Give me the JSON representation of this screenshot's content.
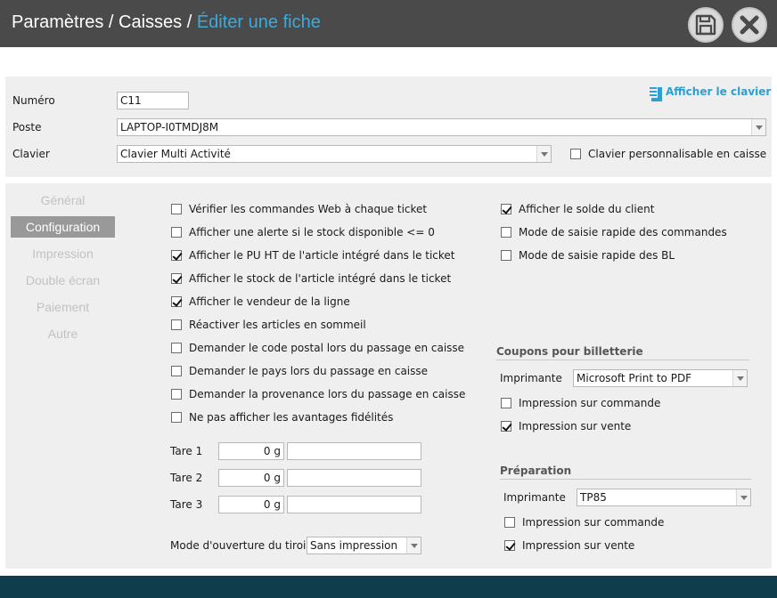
{
  "header": {
    "title_part1": "Paramètres / Caisses / ",
    "title_part2": "Éditer une fiche",
    "save_icon": "save-icon",
    "close_icon": "close-icon"
  },
  "top": {
    "numero_label": "Numéro",
    "numero_value": "C11",
    "poste_label": "Poste",
    "poste_value": "LAPTOP-I0TMDJ8M",
    "clavier_label": "Clavier",
    "clavier_value": "Clavier Multi Activité",
    "clavier_perso_label": "Clavier personnalisable en caisse",
    "clavier_perso_checked": false,
    "afficher_clavier": "Afficher le clavier"
  },
  "tabs": [
    {
      "label": "Général",
      "active": false
    },
    {
      "label": "Configuration",
      "active": true
    },
    {
      "label": "Impression",
      "active": false
    },
    {
      "label": "Double écran",
      "active": false
    },
    {
      "label": "Paiement",
      "active": false
    },
    {
      "label": "Autre",
      "active": false
    }
  ],
  "config_left": [
    {
      "label": "Vérifier les commandes Web à chaque ticket",
      "checked": false
    },
    {
      "label": "Afficher une alerte si le stock disponible <= 0",
      "checked": false
    },
    {
      "label": "Afficher le PU HT de l'article intégré dans le ticket",
      "checked": true
    },
    {
      "label": "Afficher le stock de l'article intégré dans le ticket",
      "checked": true
    },
    {
      "label": "Afficher le vendeur de la ligne",
      "checked": true
    },
    {
      "label": "Réactiver les articles en sommeil",
      "checked": false
    },
    {
      "label": "Demander le code postal lors du passage en caisse",
      "checked": false
    },
    {
      "label": "Demander le pays lors du passage en caisse",
      "checked": false
    },
    {
      "label": "Demander la provenance lors du passage en caisse",
      "checked": false
    },
    {
      "label": "Ne pas afficher les avantages fidélités",
      "checked": false
    }
  ],
  "config_right": [
    {
      "label": "Afficher le solde du client",
      "checked": true
    },
    {
      "label": "Mode de saisie rapide des commandes",
      "checked": false
    },
    {
      "label": "Mode de saisie rapide des BL",
      "checked": false
    }
  ],
  "tares": [
    {
      "label": "Tare 1",
      "value": "0 g",
      "desc": ""
    },
    {
      "label": "Tare 2",
      "value": "0 g",
      "desc": ""
    },
    {
      "label": "Tare 3",
      "value": "0 g",
      "desc": ""
    }
  ],
  "tiroir": {
    "label": "Mode d'ouverture du tiroir",
    "value": "Sans impression"
  },
  "coupons": {
    "title": "Coupons pour billetterie",
    "printer_label": "Imprimante",
    "printer_value": "Microsoft Print to PDF",
    "opt1": {
      "label": "Impression sur commande",
      "checked": false
    },
    "opt2": {
      "label": "Impression sur vente",
      "checked": true
    }
  },
  "preparation": {
    "title": "Préparation",
    "printer_label": "Imprimante",
    "printer_value": "TP85",
    "opt1": {
      "label": "Impression sur commande",
      "checked": false
    },
    "opt2": {
      "label": "Impression sur vente",
      "checked": true
    }
  },
  "colors": {
    "header_bg": "#4a4a4a",
    "accent": "#3fa9d9",
    "footer_bg": "#0f3d4b",
    "tab_active_bg": "#999999"
  }
}
